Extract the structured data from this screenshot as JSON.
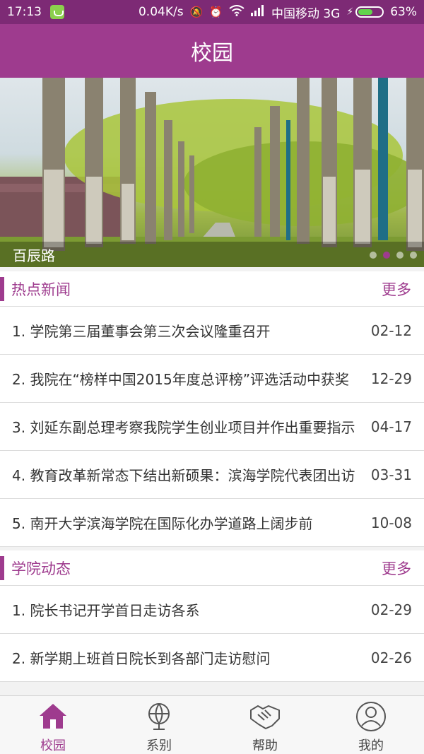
{
  "status_bar": {
    "time": "17:13",
    "speed": "0.04K/s",
    "carrier": "中国移动 3G",
    "battery": "63%",
    "battery_level": 0.63
  },
  "header": {
    "title": "校园"
  },
  "banner": {
    "caption": "百辰路",
    "active_slide_index": 1
  },
  "hot_news": {
    "title": "热点新闻",
    "more": "更多",
    "items": [
      {
        "text": "1. 学院第三届董事会第三次会议隆重召开",
        "date": "02-12"
      },
      {
        "text": "2. 我院在“榜样中国2015年度总评榜”评选活动中获奖",
        "date": "12-29"
      },
      {
        "text": "3. 刘延东副总理考察我院学生创业项目并作出重要指示",
        "date": "04-17"
      },
      {
        "text": "4. 教育改革新常态下结出新硕果：滨海学院代表团出访",
        "date": "03-31"
      },
      {
        "text": "5. 南开大学滨海学院在国际化办学道路上阔步前",
        "date": "10-08"
      }
    ]
  },
  "college_news": {
    "title": "学院动态",
    "more": "更多",
    "items": [
      {
        "text": "1. 院长书记开学首日走访各系",
        "date": "02-29"
      },
      {
        "text": "2. 新学期上班首日院长到各部门走访慰问",
        "date": "02-26"
      }
    ]
  },
  "tabbar": {
    "tabs": [
      {
        "label": "校园",
        "icon": "home-icon",
        "active": true
      },
      {
        "label": "系别",
        "icon": "globe-icon",
        "active": false
      },
      {
        "label": "帮助",
        "icon": "handshake-icon",
        "active": false
      },
      {
        "label": "我的",
        "icon": "user-icon",
        "active": false
      }
    ]
  },
  "colors": {
    "accent": "#9e3b8e",
    "status_bar": "#7d2a75"
  }
}
